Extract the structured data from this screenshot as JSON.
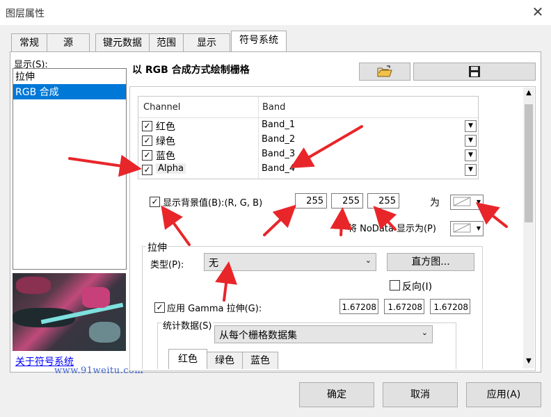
{
  "window": {
    "title": "图层属性",
    "close_glyph": "✕"
  },
  "tabs": [
    {
      "label": "常规"
    },
    {
      "label": "源"
    },
    {
      "label": "键元数据"
    },
    {
      "label": "范围"
    },
    {
      "label": "显示"
    },
    {
      "label": "符号系统"
    }
  ],
  "left": {
    "show_label": "显示(S):",
    "renderers": [
      {
        "label": "拉伸"
      },
      {
        "label": "RGB 合成",
        "selected": true
      }
    ],
    "about_link": "关于符号系统"
  },
  "header": {
    "title": "以 RGB 合成方式绘制栅格",
    "open_icon": "folder-open-icon",
    "save_icon": "floppy-disk-icon"
  },
  "channel_table": {
    "col_channel": "Channel",
    "col_band": "Band",
    "rows": [
      {
        "channel": "红色",
        "band": "Band_1",
        "checked": true
      },
      {
        "channel": "绿色",
        "band": "Band_2",
        "checked": true
      },
      {
        "channel": "蓝色",
        "band": "Band_3",
        "checked": true
      },
      {
        "channel": "Alpha",
        "band": "Band_4",
        "checked": true
      }
    ]
  },
  "background": {
    "checkbox_label": "显示背景值(B):(R, G, B)",
    "checked": true,
    "r": "255",
    "g": "255",
    "b": "255",
    "as_label": "为",
    "nodata_label": "将 NoData 显示为(P)"
  },
  "stretch": {
    "group_label": "拉伸",
    "type_label": "类型(P):",
    "type_value": "无",
    "histogram_button": "直方图...",
    "invert_label": "反向(I)",
    "invert_checked": false,
    "gamma_label": "应用 Gamma 拉伸(G):",
    "gamma_checked": true,
    "gamma_r": "1.67208",
    "gamma_g": "1.67208",
    "gamma_b": "1.67208",
    "stats_label": "统计数据(S)",
    "stats_value": "从每个栅格数据集",
    "stats_tabs": [
      "红色",
      "绿色",
      "蓝色"
    ]
  },
  "footer": {
    "ok": "确定",
    "cancel": "取消",
    "apply": "应用(A)"
  },
  "watermark": "www.91weitu.com",
  "colors": {
    "accent": "#0078d7",
    "arrow": "#e8262a"
  }
}
